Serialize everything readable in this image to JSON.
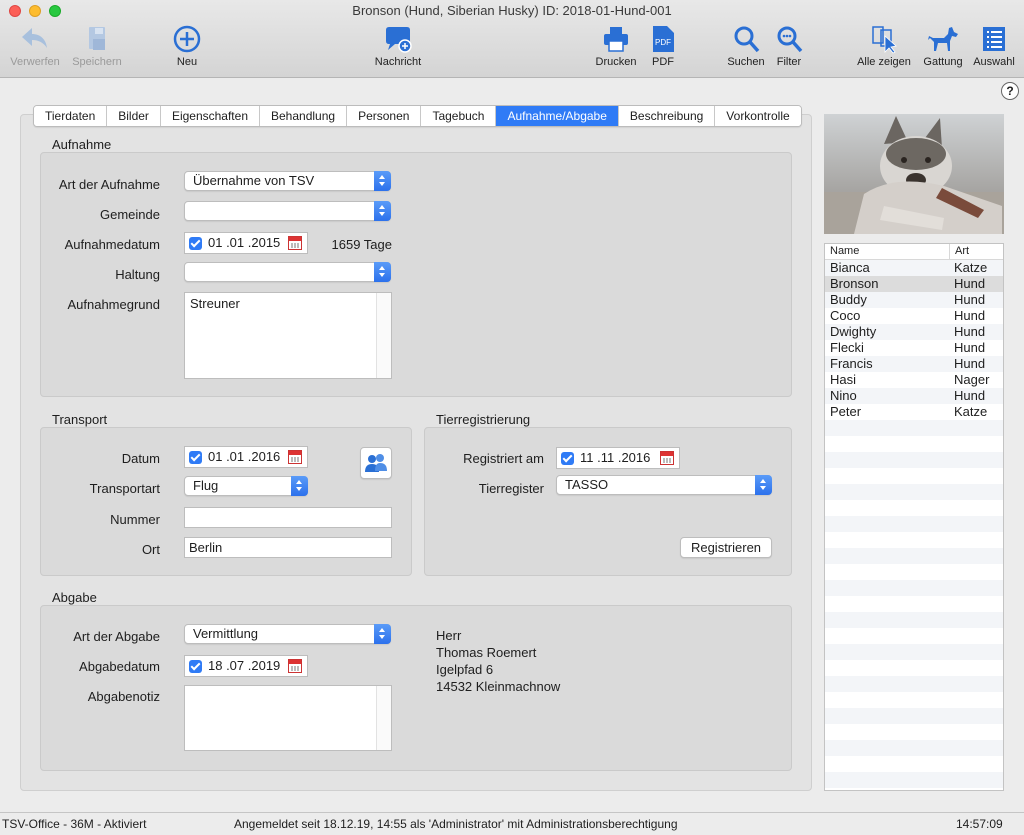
{
  "window": {
    "title": "Bronson (Hund, Siberian Husky) ID: 2018-01-Hund-001"
  },
  "colors": {
    "accent": "#2f7bf6",
    "toolbar_icon": "#2a6fd4"
  },
  "toolbar": {
    "verwerfen": "Verwerfen",
    "speichern": "Speichern",
    "neu": "Neu",
    "nachricht": "Nachricht",
    "drucken": "Drucken",
    "pdf": "PDF",
    "suchen": "Suchen",
    "filter": "Filter",
    "alle_zeigen": "Alle zeigen",
    "gattung": "Gattung",
    "auswahl": "Auswahl",
    "pdf_icon_text": "PDF"
  },
  "help_label": "?",
  "tabs": [
    "Tierdaten",
    "Bilder",
    "Eigenschaften",
    "Behandlung",
    "Personen",
    "Tagebuch",
    "Aufnahme/Abgabe",
    "Beschreibung",
    "Vorkontrolle"
  ],
  "active_tab": "Aufnahme/Abgabe",
  "aufnahme": {
    "title": "Aufnahme",
    "art_label": "Art der Aufnahme",
    "art_value": "Übernahme von TSV",
    "gemeinde_label": "Gemeinde",
    "gemeinde_value": "",
    "datum_label": "Aufnahmedatum",
    "datum_value": "01 .01 .2015",
    "tage": "1659 Tage",
    "haltung_label": "Haltung",
    "haltung_value": "",
    "grund_label": "Aufnahmegrund",
    "grund_value": "Streuner"
  },
  "transport": {
    "title": "Transport",
    "datum_label": "Datum",
    "datum_value": "01 .01 .2016",
    "art_label": "Transportart",
    "art_value": "Flug",
    "nummer_label": "Nummer",
    "nummer_value": "",
    "ort_label": "Ort",
    "ort_value": "Berlin"
  },
  "tierregistrierung": {
    "title": "Tierregistrierung",
    "registriert_label": "Registriert am",
    "registriert_value": "11 .11 .2016",
    "register_label": "Tierregister",
    "register_value": "TASSO",
    "button": "Registrieren"
  },
  "abgabe": {
    "title": "Abgabe",
    "art_label": "Art der Abgabe",
    "art_value": "Vermittlung",
    "datum_label": "Abgabedatum",
    "datum_value": "18 .07 .2019",
    "notiz_label": "Abgabenotiz",
    "notiz_value": "",
    "address": [
      "Herr",
      "Thomas Roemert",
      "Igelpfad 6",
      "14532 Kleinmachnow"
    ]
  },
  "animal_list": {
    "columns": [
      "Name",
      "Art"
    ],
    "rows": [
      [
        "Bianca",
        "Katze"
      ],
      [
        "Bronson",
        "Hund"
      ],
      [
        "Buddy",
        "Hund"
      ],
      [
        "Coco",
        "Hund"
      ],
      [
        "Dwighty",
        "Hund"
      ],
      [
        "Flecki",
        "Hund"
      ],
      [
        "Francis",
        "Hund"
      ],
      [
        "Hasi",
        "Nager"
      ],
      [
        "Nino",
        "Hund"
      ],
      [
        "Peter",
        "Katze"
      ]
    ],
    "selected": "Bronson"
  },
  "status": {
    "left": "TSV-Office - 36M - Aktiviert",
    "center": "Angemeldet seit 18.12.19, 14:55 als 'Administrator' mit Administrationsberechtigung",
    "time": "14:57:09"
  }
}
